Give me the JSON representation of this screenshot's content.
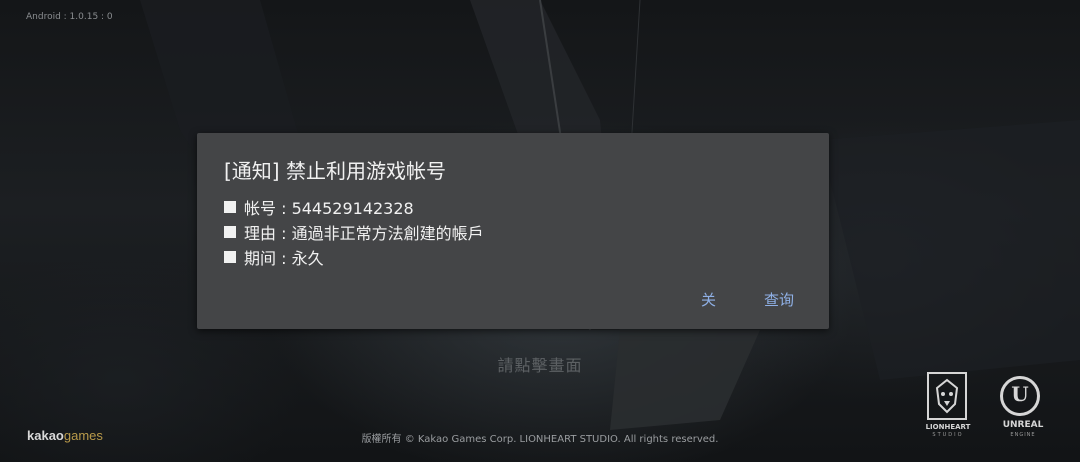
{
  "version_text": "Android : 1.0.15 : 0",
  "dialog": {
    "title": "[通知] 禁止利用游戏帐号",
    "lines": [
      "帐号 : 544529142328",
      "理由 : 通過非正常方法創建的帳戶",
      "期间 : 永久"
    ],
    "close_label": "关",
    "query_label": "查询"
  },
  "tap_hint": "請點擊畫面",
  "copyright": "版權所有 © Kakao Games Corp. LIONHEART STUDIO. All rights reserved.",
  "logos": {
    "kakao_a": "kakao",
    "kakao_b": "games",
    "lionheart": "LIONHEART",
    "lionheart_sub": "STUDIO",
    "unreal": "UNREAL",
    "unreal_sub": "ENGINE"
  },
  "colors": {
    "dialog_bg": "#444547",
    "button_text": "#8fb0e6"
  }
}
